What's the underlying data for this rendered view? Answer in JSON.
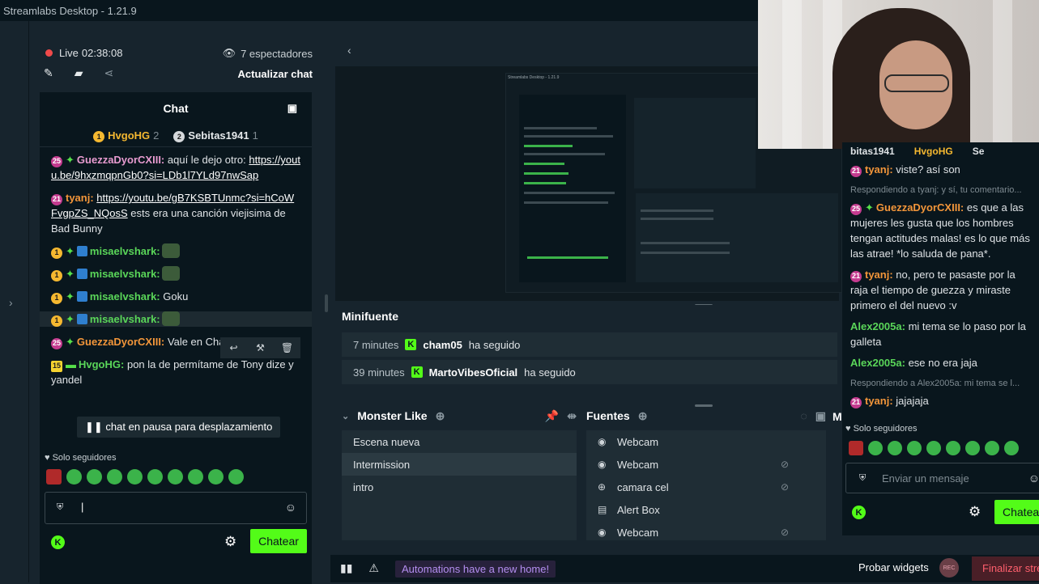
{
  "app": {
    "title": "Streamlabs Desktop - 1.21.9"
  },
  "stream": {
    "live_label": "Live",
    "live_time": "02:38:08",
    "viewers": "7 espectadores",
    "update_chat": "Actualizar chat"
  },
  "chat": {
    "title": "Chat",
    "top_users": [
      {
        "badge": "1",
        "name": "HvgoHG",
        "count": "2"
      },
      {
        "badge": "2",
        "name": "Sebitas1941",
        "count": "1"
      }
    ],
    "messages": [
      {
        "badge": "25",
        "user": "GuezzaDyorCXIII:",
        "text": "aquí le dejo otro:",
        "link": "https://youtu.be/9hxzmqpnGb0?si=LDb1l7YLd97nwSap"
      },
      {
        "badge": "21",
        "user": "tyanj:",
        "link": "https://youtu.be/gB7KSBTUnmc?si=hCoWFvgpZS_NQosS",
        "text": "ests era una canción viejisima de Bad Bunny"
      },
      {
        "badge": "1",
        "user": "misaelvshark:",
        "text": ""
      },
      {
        "badge": "1",
        "user": "misaelvshark:",
        "text": ""
      },
      {
        "badge": "1",
        "user": "misaelvshark:",
        "text": "Goku"
      },
      {
        "badge": "1",
        "user": "misaelvshark:",
        "text": ""
      },
      {
        "badge": "25",
        "user": "GuezzaDyorCXIII:",
        "text": "Vale en Changualand!"
      },
      {
        "badge": "15",
        "user": "HvgoHG:",
        "text": "pon la de permítame de Tony dize y yandel"
      }
    ],
    "paused": "chat en pausa para desplazamiento",
    "followers_only": "Solo seguidores",
    "send_button": "Chatear"
  },
  "minifeed": {
    "title": "Minifuente",
    "rows": [
      {
        "time": "7 minutes",
        "user": "cham05",
        "action": "ha seguido"
      },
      {
        "time": "39 minutes",
        "user": "MartoVibesOficial",
        "action": "ha seguido"
      }
    ]
  },
  "scenes": {
    "title": "Monster Like",
    "items": [
      "Escena nueva",
      "Intermission",
      "intro"
    ],
    "selected": 1
  },
  "sources": {
    "title": "Fuentes",
    "items": [
      {
        "icon": "camera-icon",
        "name": "Webcam"
      },
      {
        "icon": "camera-icon",
        "name": "Webcam"
      },
      {
        "icon": "globe-icon",
        "name": "camara cel"
      },
      {
        "icon": "alert-icon",
        "name": "Alert Box"
      },
      {
        "icon": "camera-icon",
        "name": "Webcam"
      }
    ]
  },
  "mixer_label": "M",
  "bottom": {
    "automations": "Automations have a new home!",
    "probar": "Probar widgets",
    "rec": "REC",
    "end": "Finalizar stre"
  },
  "right_chat": {
    "top_users": [
      "bitas1941",
      "HvgoHG",
      "Se"
    ],
    "messages": [
      {
        "badge": "21",
        "user": "tyanj:",
        "text": "viste? así son"
      },
      {
        "reply": "Respondiendo a tyanj: y sí, tu comentario..."
      },
      {
        "badge": "25",
        "user": "GuezzaDyorCXIII:",
        "text": "es que a las mujeres les gusta que los hombres tengan actitudes malas! es lo que más las atrae! *lo saluda de pana*."
      },
      {
        "badge": "21",
        "user": "tyanj:",
        "text": "no, pero te pasaste por la raja el tiempo de guezza y miraste primero el del nuevo :v"
      },
      {
        "user": "Alex2005a:",
        "text": "mi tema se lo paso por la galleta"
      },
      {
        "user": "Alex2005a:",
        "text": "ese no era jaja"
      },
      {
        "reply": "Respondiendo a Alex2005a: mi tema se l..."
      },
      {
        "badge": "21",
        "user": "tyanj:",
        "text": "jajajaja"
      }
    ],
    "followers_only": "Solo seguidores",
    "placeholder": "Enviar un mensaje",
    "send_button": "Chatea"
  }
}
